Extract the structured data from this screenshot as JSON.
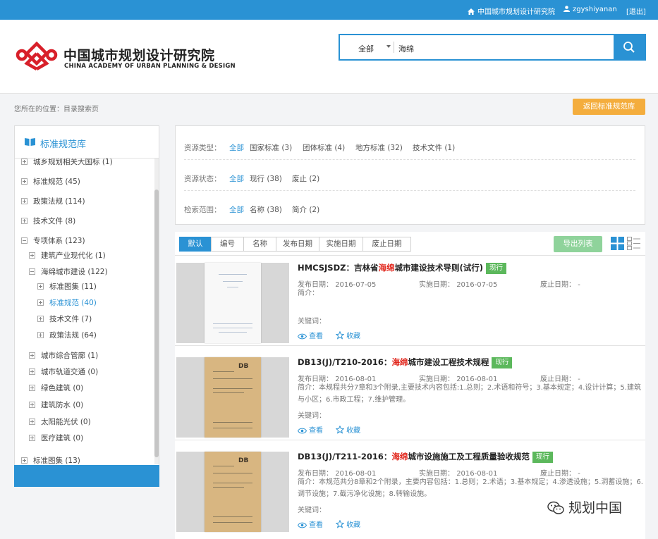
{
  "topbar": {
    "home_label": "中国城市规划设计研究院",
    "user_label": "zgyshiyanan",
    "logout_label": "[退出]"
  },
  "brand": {
    "name_cn": "中国城市规划设计研究院",
    "name_en": "CHINA ACADEMY OF URBAN PLANNING & DESIGN",
    "logo_color": "#d8202a"
  },
  "search": {
    "scope": "全部",
    "query": "海绵"
  },
  "breadcrumb": "您所在的位置：目录搜索页",
  "back_button": "返回标准规范库",
  "sidebar": {
    "title": "标准规范库",
    "items": [
      {
        "label": "城乡规划相关大国标 (1)"
      },
      {
        "label": "标准规范 (45)"
      },
      {
        "label": "政策法规 (114)"
      },
      {
        "label": "技术文件 (8)"
      },
      {
        "label": "专项体系 (123)"
      },
      {
        "label": "建筑产业现代化 (1)"
      },
      {
        "label": "海绵城市建设 (122)"
      },
      {
        "label": "标准图集 (11)"
      },
      {
        "label": "标准规范 (40)"
      },
      {
        "label": "技术文件 (7)"
      },
      {
        "label": "政策法规 (64)"
      },
      {
        "label": "城市综合管廊 (1)"
      },
      {
        "label": "城市轨道交通 (0)"
      },
      {
        "label": "绿色建筑 (0)"
      },
      {
        "label": "建筑防水 (0)"
      },
      {
        "label": "太阳能光伏 (0)"
      },
      {
        "label": "医疗建筑 (0)"
      },
      {
        "label": "标准图集 (13)"
      }
    ]
  },
  "filters": [
    {
      "label": "资源类型：",
      "options": [
        "全部",
        "国家标准 (3)",
        "团体标准 (4)",
        "地方标准 (32)",
        "技术文件 (1)"
      ]
    },
    {
      "label": "资源状态：",
      "options": [
        "全部",
        "现行 (38)",
        "废止 (2)"
      ]
    },
    {
      "label": "检索范围：",
      "options": [
        "全部",
        "名称 (38)",
        "简介 (2)"
      ]
    }
  ],
  "sort_tabs": [
    "默认",
    "编号",
    "名称",
    "发布日期",
    "实施日期",
    "废止日期"
  ],
  "export_label": "导出列表",
  "labels": {
    "publish": "发布日期：",
    "implement": "实施日期：",
    "abolish": "废止日期：",
    "intro": "简介：",
    "keywords": "关键词：",
    "view": "查看",
    "favorite": "收藏",
    "status_current": "现行"
  },
  "results": [
    {
      "code": "HMCSJSDZ：",
      "title_pre": "吉林省",
      "title_hl": "海绵",
      "title_post": "城市建设技术导则(试行)",
      "publish": "2016-07-05",
      "implement": "2016-07-05",
      "abolish": "-",
      "intro": ""
    },
    {
      "code": "DB13(J)/T210-2016：",
      "title_pre": "",
      "title_hl": "海绵",
      "title_post": "城市建设工程技术规程",
      "publish": "2016-08-01",
      "implement": "2016-08-01",
      "abolish": "-",
      "intro": "本规程共分7章和3个附录,主要技术内容包括:1.总则；2.术语和符号；3.基本规定；4.设计计算；5.建筑与小区；6.市政工程；7.维护管理。"
    },
    {
      "code": "DB13(J)/T211-2016：",
      "title_pre": "",
      "title_hl": "海绵",
      "title_post": "城市设施施工及工程质量验收规范",
      "publish": "2016-08-01",
      "implement": "2016-08-01",
      "abolish": "-",
      "intro": "本规范共分8章和2个附录，主要内容包括：1.总则；2.术语；3.基本规定；4.渗透设施；5.洞蓄设施；6.调节设施；7.截污净化设施；8.转输设施。"
    }
  ],
  "watermark": "规划中国"
}
